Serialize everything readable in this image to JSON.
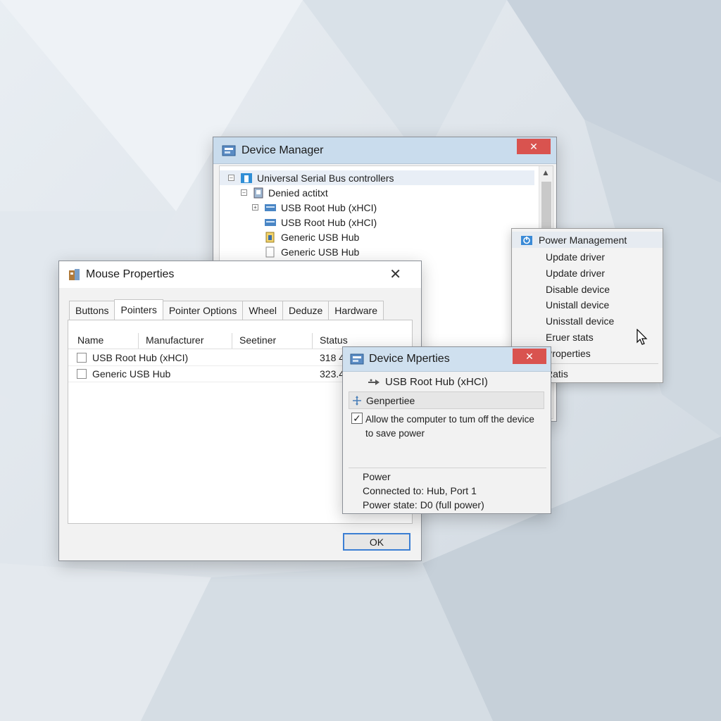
{
  "device_manager": {
    "title": "Device Manager",
    "close_label": "✕",
    "tree": [
      {
        "label": "Universal Serial Bus controllers",
        "expander": "–"
      },
      {
        "label": "Denied actitxt",
        "expander": "–"
      },
      {
        "label": "USB Root Hub (xHCI)",
        "expander": "+"
      },
      {
        "label": "USB Root Hub (xHCI)"
      },
      {
        "label": "Generic USB Hub"
      },
      {
        "label": "Generic USB Hub"
      }
    ]
  },
  "mouse_properties": {
    "title": "Mouse Properties",
    "close_label": "✕",
    "tabs": [
      "Buttons",
      "Pointers",
      "Pointer Options",
      "Wheel",
      "Deduze",
      "Hardware"
    ],
    "columns": [
      "Name",
      "Manufacturer",
      "Seetiner",
      "Status"
    ],
    "rows": [
      {
        "name": "USB Root Hub (xHCI)",
        "status": "318 4"
      },
      {
        "name": "Generic USB Hub",
        "status": "323.4"
      }
    ],
    "ok_label": "OK"
  },
  "context_menu": {
    "header": "Power Management",
    "items": [
      "Update driver",
      "Update driver",
      "Disable device",
      "Unistall device",
      "Unisstall device",
      "Eruer stats",
      "Properties"
    ],
    "footer": "Ratis"
  },
  "device_properties": {
    "title": "Device Mperties",
    "close_label": "✕",
    "device": "USB Root Hub (xHCI)",
    "group": "Genpertiee",
    "checkbox_label_line1": "Allow the computer to tum off the device",
    "checkbox_label_line2": "to save power",
    "checked_mark": "✓",
    "power_heading": "Power",
    "connected_to": "Connected to: Hub, Port 1",
    "power_state": "Power state: D0  (full power)"
  },
  "colors": {
    "close_button": "#d9534f",
    "titlebar_blue": "#c9dced",
    "ok_border": "#3c7fd4",
    "selection": "#e8eef6"
  }
}
